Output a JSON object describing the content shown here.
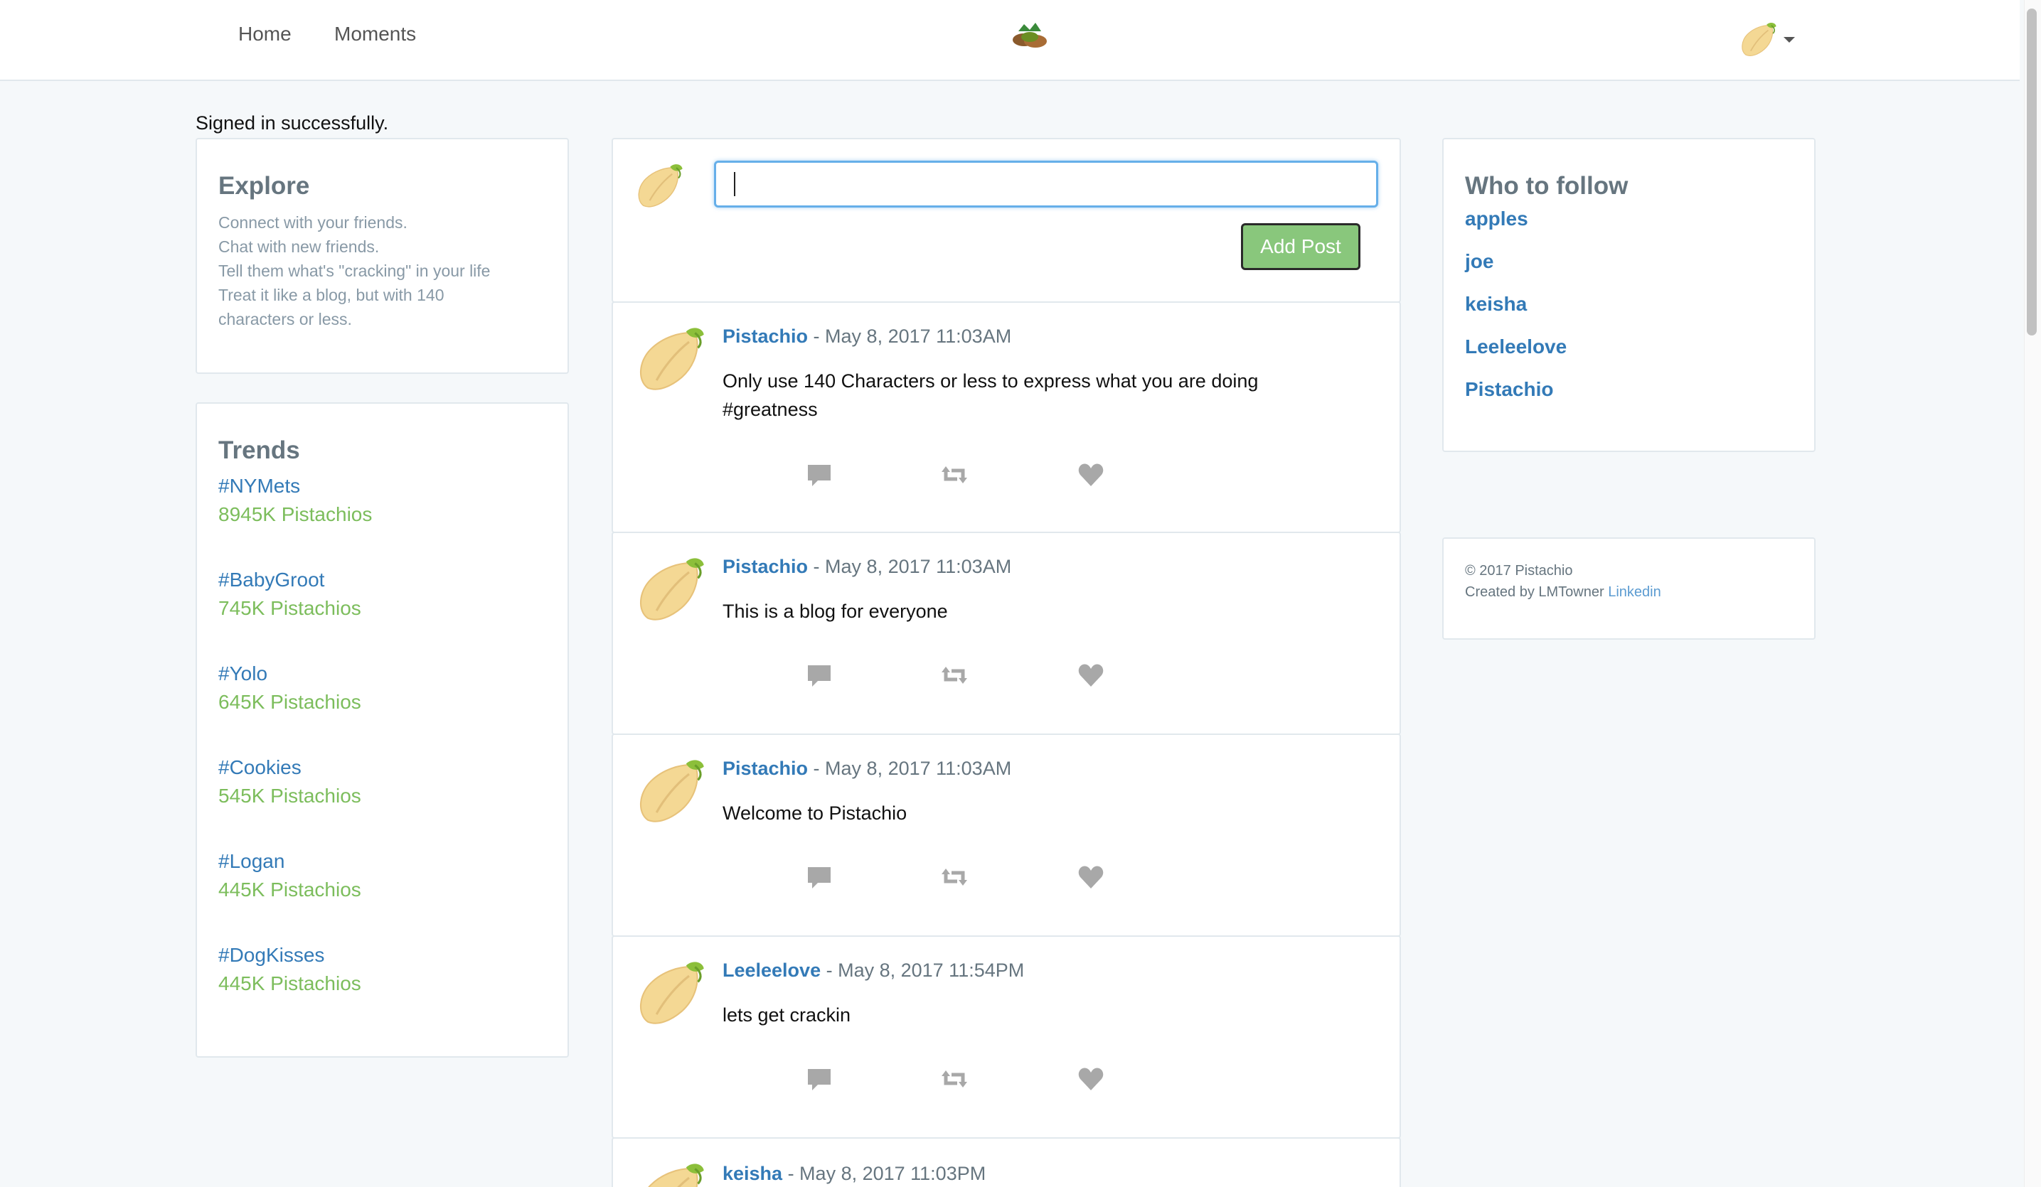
{
  "nav": {
    "home": "Home",
    "moments": "Moments",
    "logo_icon": "pistachio-logo-icon",
    "avatar_icon": "pistachio-avatar-icon"
  },
  "flash": "Signed in successfully.",
  "explore": {
    "title": "Explore",
    "lines": [
      "Connect with your friends.",
      "Chat with new friends.",
      "Tell them what's \"cracking\" in your life",
      "Treat it like a blog, but with 140",
      "characters or less."
    ]
  },
  "trends": {
    "title": "Trends",
    "items": [
      {
        "tag": "#NYMets",
        "count": "8945K Pistachios"
      },
      {
        "tag": "#BabyGroot",
        "count": "745K Pistachios"
      },
      {
        "tag": "#Yolo",
        "count": "645K Pistachios"
      },
      {
        "tag": "#Cookies",
        "count": "545K Pistachios"
      },
      {
        "tag": "#Logan",
        "count": "445K Pistachios"
      },
      {
        "tag": "#DogKisses",
        "count": "445K Pistachios"
      }
    ]
  },
  "composer": {
    "value": "",
    "button": "Add Post"
  },
  "posts": [
    {
      "author": "Pistachio",
      "time": " - May 8, 2017 11:03AM",
      "body": "Only use 140 Characters or less to express what you are doing #greatness"
    },
    {
      "author": "Pistachio",
      "time": " - May 8, 2017 11:03AM",
      "body": "This is a blog for everyone"
    },
    {
      "author": "Pistachio",
      "time": " - May 8, 2017 11:03AM",
      "body": "Welcome to Pistachio"
    },
    {
      "author": "Leeleelove",
      "time": " - May 8, 2017 11:54PM",
      "body": "lets get crackin"
    },
    {
      "author": "keisha",
      "time": " - May 8, 2017 11:03PM",
      "body": ""
    }
  ],
  "follow": {
    "title": "Who to follow",
    "users": [
      "apples",
      "joe",
      "keisha",
      "Leeleelove",
      "Pistachio"
    ]
  },
  "footer": {
    "copyright": "© 2017 Pistachio",
    "created_by": "Created by LMTowner",
    "link": "Linkedin"
  },
  "colors": {
    "link": "#337ab7",
    "trend_count": "#7cbd5c",
    "add_post_bg": "#89c77c",
    "icon_grey": "#a8a8a8"
  }
}
